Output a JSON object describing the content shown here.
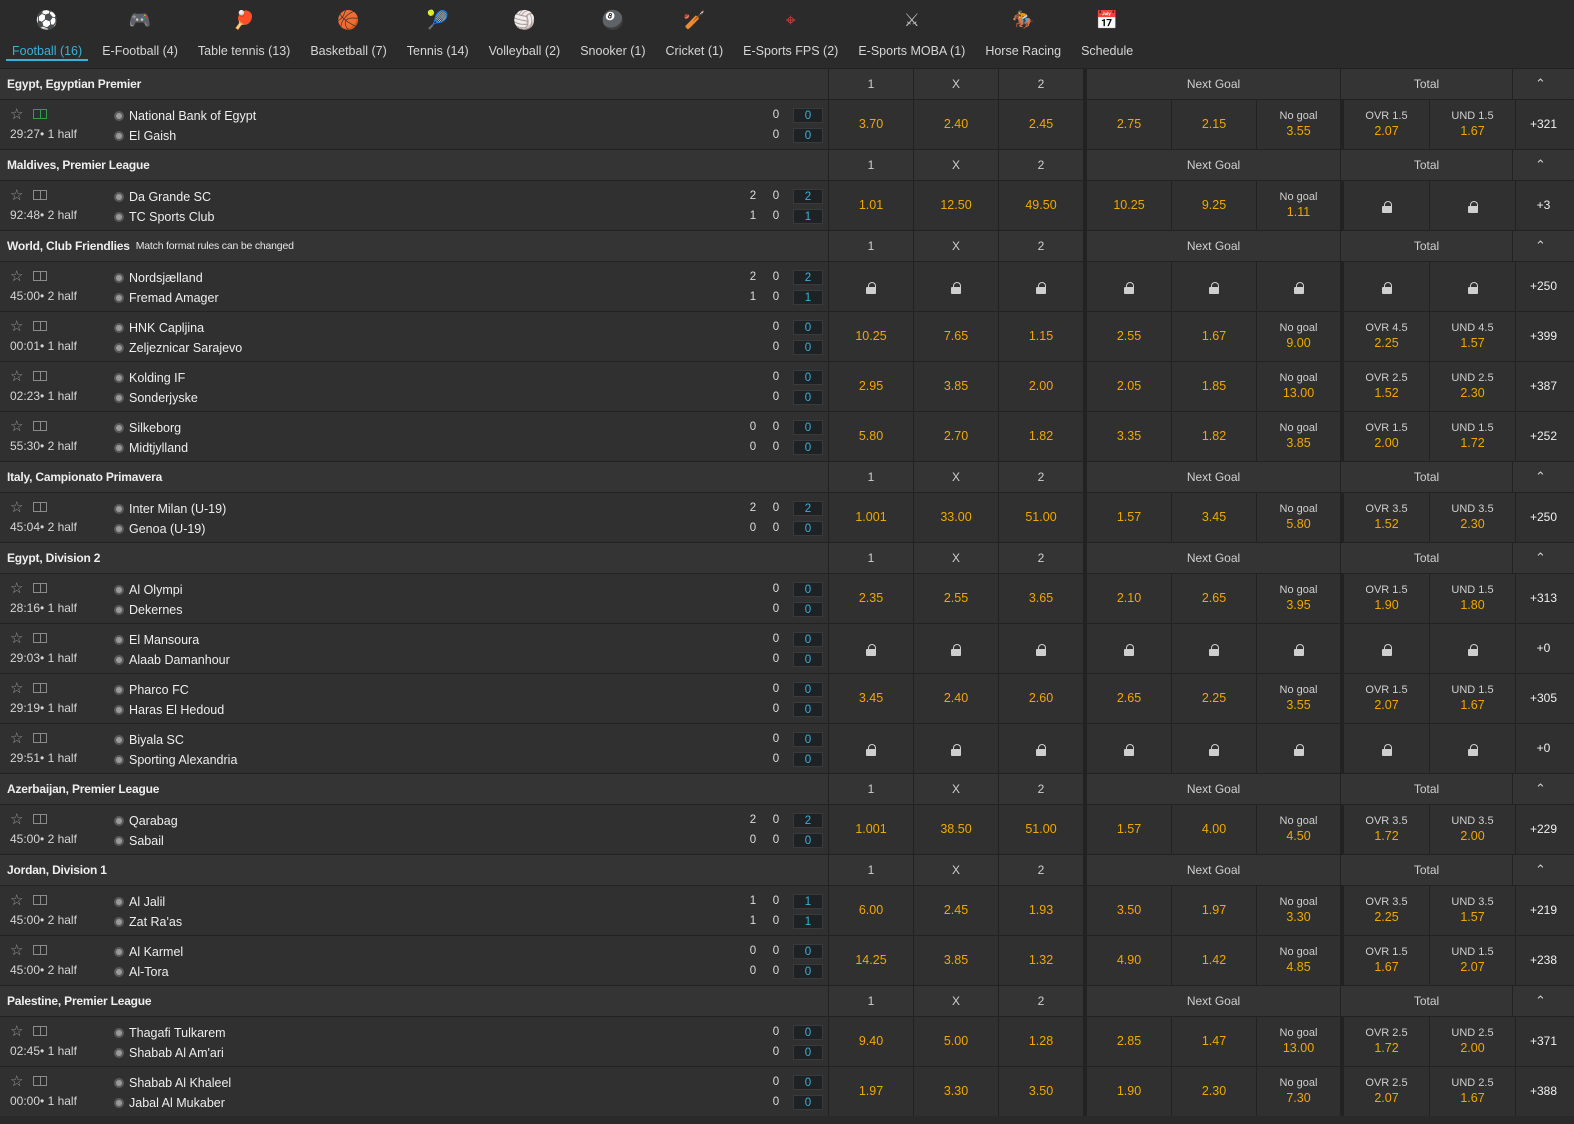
{
  "nav": [
    {
      "label": "Football (16)",
      "icon": "soccer-ball-icon",
      "glyph": "⚽",
      "color": "#e8e8e8",
      "active": true
    },
    {
      "label": "E-Football (4)",
      "icon": "e-football-icon",
      "glyph": "🎮",
      "color": "#9aa0a6",
      "active": false
    },
    {
      "label": "Table tennis (13)",
      "icon": "table-tennis-icon",
      "glyph": "🏓",
      "color": "#e05a4a",
      "active": false
    },
    {
      "label": "Basketball (7)",
      "icon": "basketball-icon",
      "glyph": "🏀",
      "color": "#e0642a",
      "active": false
    },
    {
      "label": "Tennis (14)",
      "icon": "tennis-ball-icon",
      "glyph": "🎾",
      "color": "#6cc04a",
      "active": false
    },
    {
      "label": "Volleyball (2)",
      "icon": "volleyball-icon",
      "glyph": "🏐",
      "color": "#f2c02e",
      "active": false
    },
    {
      "label": "Snooker (1)",
      "icon": "snooker-icon",
      "glyph": "🎱",
      "color": "#d23c3c",
      "active": false
    },
    {
      "label": "Cricket (1)",
      "icon": "cricket-icon",
      "glyph": "🏏",
      "color": "#e09a6a",
      "active": false
    },
    {
      "label": "E-Sports FPS (2)",
      "icon": "crosshair-icon",
      "glyph": "⌖",
      "color": "#d23c3c",
      "active": false
    },
    {
      "label": "E-Sports MOBA (1)",
      "icon": "crossed-swords-icon",
      "glyph": "⚔",
      "color": "#b8b8b8",
      "active": false
    },
    {
      "label": "Horse Racing",
      "icon": "horse-racing-icon",
      "glyph": "🏇",
      "color": "#c0703a",
      "active": false
    },
    {
      "label": "Schedule",
      "icon": "calendar-icon",
      "glyph": "📅",
      "color": "#f2c02e",
      "active": false
    }
  ],
  "headers": {
    "h1": "1",
    "hx": "X",
    "h2": "2",
    "next_goal": "Next Goal",
    "total": "Total",
    "collapse": "^"
  },
  "leagues": [
    {
      "name": "Egypt, Egyptian Premier",
      "note": "",
      "matches": [
        {
          "time": "29:27• 1 half",
          "live": true,
          "t1": "National Bank of Egypt",
          "t2": "El Gaish",
          "s1": [
            "",
            "0",
            "0"
          ],
          "s2": [
            "",
            "0",
            "0"
          ],
          "o1": "3.70",
          "ox": "2.40",
          "o2": "2.45",
          "n1": "2.75",
          "n2": "2.15",
          "ng_lbl": "No goal",
          "ng": "3.55",
          "ov_lbl": "OVR 1.5",
          "ov": "2.07",
          "un_lbl": "UND 1.5",
          "un": "1.67",
          "more": "+321"
        }
      ]
    },
    {
      "name": "Maldives, Premier League",
      "note": "",
      "matches": [
        {
          "time": "92:48• 2 half",
          "live": false,
          "t1": "Da Grande SC",
          "t2": "TC Sports Club",
          "s1": [
            "2",
            "0",
            "2"
          ],
          "s2": [
            "1",
            "0",
            "1"
          ],
          "o1": "1.01",
          "ox": "12.50",
          "o2": "49.50",
          "n1": "10.25",
          "n2": "9.25",
          "ng_lbl": "No goal",
          "ng": "1.11",
          "ov_lbl": "",
          "ov": "LOCK",
          "un_lbl": "",
          "un": "LOCK",
          "more": "+3"
        }
      ]
    },
    {
      "name": "World, Club Friendlies",
      "note": "Match format rules can be changed",
      "matches": [
        {
          "time": "45:00• 2 half",
          "live": false,
          "t1": "Nordsjælland",
          "t2": "Fremad Amager",
          "s1": [
            "2",
            "0",
            "2"
          ],
          "s2": [
            "1",
            "0",
            "1"
          ],
          "o1": "LOCK",
          "ox": "LOCK",
          "o2": "LOCK",
          "n1": "LOCK",
          "n2": "LOCK",
          "ng_lbl": "",
          "ng": "LOCK",
          "ov_lbl": "",
          "ov": "LOCK",
          "un_lbl": "",
          "un": "LOCK",
          "more": "+250"
        },
        {
          "time": "00:01• 1 half",
          "live": false,
          "t1": "HNK Capljina",
          "t2": "Zeljeznicar Sarajevo",
          "s1": [
            "",
            "0",
            "0"
          ],
          "s2": [
            "",
            "0",
            "0"
          ],
          "o1": "10.25",
          "ox": "7.65",
          "o2": "1.15",
          "n1": "2.55",
          "n2": "1.67",
          "ng_lbl": "No goal",
          "ng": "9.00",
          "ov_lbl": "OVR 4.5",
          "ov": "2.25",
          "un_lbl": "UND 4.5",
          "un": "1.57",
          "more": "+399"
        },
        {
          "time": "02:23• 1 half",
          "live": false,
          "t1": "Kolding IF",
          "t2": "Sonderjyske",
          "s1": [
            "",
            "0",
            "0"
          ],
          "s2": [
            "",
            "0",
            "0"
          ],
          "o1": "2.95",
          "ox": "3.85",
          "o2": "2.00",
          "n1": "2.05",
          "n2": "1.85",
          "ng_lbl": "No goal",
          "ng": "13.00",
          "ov_lbl": "OVR 2.5",
          "ov": "1.52",
          "un_lbl": "UND 2.5",
          "un": "2.30",
          "more": "+387"
        },
        {
          "time": "55:30• 2 half",
          "live": false,
          "t1": "Silkeborg",
          "t2": "Midtjylland",
          "s1": [
            "0",
            "0",
            "0"
          ],
          "s2": [
            "0",
            "0",
            "0"
          ],
          "o1": "5.80",
          "ox": "2.70",
          "o2": "1.82",
          "n1": "3.35",
          "n2": "1.82",
          "ng_lbl": "No goal",
          "ng": "3.85",
          "ov_lbl": "OVR 1.5",
          "ov": "2.00",
          "un_lbl": "UND 1.5",
          "un": "1.72",
          "more": "+252"
        }
      ]
    },
    {
      "name": "Italy, Campionato Primavera",
      "note": "",
      "matches": [
        {
          "time": "45:04• 2 half",
          "live": false,
          "t1": "Inter Milan (U-19)",
          "t2": "Genoa (U-19)",
          "s1": [
            "2",
            "0",
            "2"
          ],
          "s2": [
            "0",
            "0",
            "0"
          ],
          "o1": "1.001",
          "ox": "33.00",
          "o2": "51.00",
          "n1": "1.57",
          "n2": "3.45",
          "ng_lbl": "No goal",
          "ng": "5.80",
          "ov_lbl": "OVR 3.5",
          "ov": "1.52",
          "un_lbl": "UND 3.5",
          "un": "2.30",
          "more": "+250"
        }
      ]
    },
    {
      "name": "Egypt, Division 2",
      "note": "",
      "matches": [
        {
          "time": "28:16• 1 half",
          "live": false,
          "t1": "Al Olympi",
          "t2": "Dekernes",
          "s1": [
            "",
            "0",
            "0"
          ],
          "s2": [
            "",
            "0",
            "0"
          ],
          "o1": "2.35",
          "ox": "2.55",
          "o2": "3.65",
          "n1": "2.10",
          "n2": "2.65",
          "ng_lbl": "No goal",
          "ng": "3.95",
          "ov_lbl": "OVR 1.5",
          "ov": "1.90",
          "un_lbl": "UND 1.5",
          "un": "1.80",
          "more": "+313"
        },
        {
          "time": "29:03• 1 half",
          "live": false,
          "t1": "El Mansoura",
          "t2": "Alaab Damanhour",
          "s1": [
            "",
            "0",
            "0"
          ],
          "s2": [
            "",
            "0",
            "0"
          ],
          "o1": "LOCK",
          "ox": "LOCK",
          "o2": "LOCK",
          "n1": "LOCK",
          "n2": "LOCK",
          "ng_lbl": "",
          "ng": "LOCK",
          "ov_lbl": "",
          "ov": "LOCK",
          "un_lbl": "",
          "un": "LOCK",
          "more": "+0"
        },
        {
          "time": "29:19• 1 half",
          "live": false,
          "t1": "Pharco FC",
          "t2": "Haras El Hedoud",
          "s1": [
            "",
            "0",
            "0"
          ],
          "s2": [
            "",
            "0",
            "0"
          ],
          "o1": "3.45",
          "ox": "2.40",
          "o2": "2.60",
          "n1": "2.65",
          "n2": "2.25",
          "ng_lbl": "No goal",
          "ng": "3.55",
          "ov_lbl": "OVR 1.5",
          "ov": "2.07",
          "un_lbl": "UND 1.5",
          "un": "1.67",
          "more": "+305"
        },
        {
          "time": "29:51• 1 half",
          "live": false,
          "t1": "Biyala SC",
          "t2": "Sporting Alexandria",
          "s1": [
            "",
            "0",
            "0"
          ],
          "s2": [
            "",
            "0",
            "0"
          ],
          "o1": "LOCK",
          "ox": "LOCK",
          "o2": "LOCK",
          "n1": "LOCK",
          "n2": "LOCK",
          "ng_lbl": "",
          "ng": "LOCK",
          "ov_lbl": "",
          "ov": "LOCK",
          "un_lbl": "",
          "un": "LOCK",
          "more": "+0"
        }
      ]
    },
    {
      "name": "Azerbaijan, Premier League",
      "note": "",
      "matches": [
        {
          "time": "45:00• 2 half",
          "live": false,
          "t1": "Qarabag",
          "t2": "Sabail",
          "s1": [
            "2",
            "0",
            "2"
          ],
          "s2": [
            "0",
            "0",
            "0"
          ],
          "o1": "1.001",
          "ox": "38.50",
          "o2": "51.00",
          "n1": "1.57",
          "n2": "4.00",
          "ng_lbl": "No goal",
          "ng": "4.50",
          "ov_lbl": "OVR 3.5",
          "ov": "1.72",
          "un_lbl": "UND 3.5",
          "un": "2.00",
          "more": "+229"
        }
      ]
    },
    {
      "name": "Jordan, Division 1",
      "note": "",
      "matches": [
        {
          "time": "45:00• 2 half",
          "live": false,
          "t1": "Al Jalil",
          "t2": "Zat Ra'as",
          "s1": [
            "1",
            "0",
            "1"
          ],
          "s2": [
            "1",
            "0",
            "1"
          ],
          "o1": "6.00",
          "ox": "2.45",
          "o2": "1.93",
          "n1": "3.50",
          "n2": "1.97",
          "ng_lbl": "No goal",
          "ng": "3.30",
          "ov_lbl": "OVR 3.5",
          "ov": "2.25",
          "un_lbl": "UND 3.5",
          "un": "1.57",
          "more": "+219"
        },
        {
          "time": "45:00• 2 half",
          "live": false,
          "t1": "Al Karmel",
          "t2": "Al-Tora",
          "s1": [
            "0",
            "0",
            "0"
          ],
          "s2": [
            "0",
            "0",
            "0"
          ],
          "o1": "14.25",
          "ox": "3.85",
          "o2": "1.32",
          "n1": "4.90",
          "n2": "1.42",
          "ng_lbl": "No goal",
          "ng": "4.85",
          "ov_lbl": "OVR 1.5",
          "ov": "1.67",
          "un_lbl": "UND 1.5",
          "un": "2.07",
          "more": "+238"
        }
      ]
    },
    {
      "name": "Palestine, Premier League",
      "note": "",
      "matches": [
        {
          "time": "02:45• 1 half",
          "live": false,
          "t1": "Thagafi Tulkarem",
          "t2": "Shabab Al Am'ari",
          "s1": [
            "",
            "0",
            "0"
          ],
          "s2": [
            "",
            "0",
            "0"
          ],
          "o1": "9.40",
          "ox": "5.00",
          "o2": "1.28",
          "n1": "2.85",
          "n2": "1.47",
          "ng_lbl": "No goal",
          "ng": "13.00",
          "ov_lbl": "OVR 2.5",
          "ov": "1.72",
          "un_lbl": "UND 2.5",
          "un": "2.00",
          "more": "+371"
        },
        {
          "time": "00:00• 1 half",
          "live": false,
          "t1": "Shabab Al Khaleel",
          "t2": "Jabal Al Mukaber",
          "s1": [
            "",
            "0",
            "0"
          ],
          "s2": [
            "",
            "0",
            "0"
          ],
          "o1": "1.97",
          "ox": "3.30",
          "o2": "3.50",
          "n1": "1.90",
          "n2": "2.30",
          "ng_lbl": "No goal",
          "ng": "7.30",
          "ov_lbl": "OVR 2.5",
          "ov": "2.07",
          "un_lbl": "UND 2.5",
          "un": "1.67",
          "more": "+388"
        }
      ]
    }
  ]
}
